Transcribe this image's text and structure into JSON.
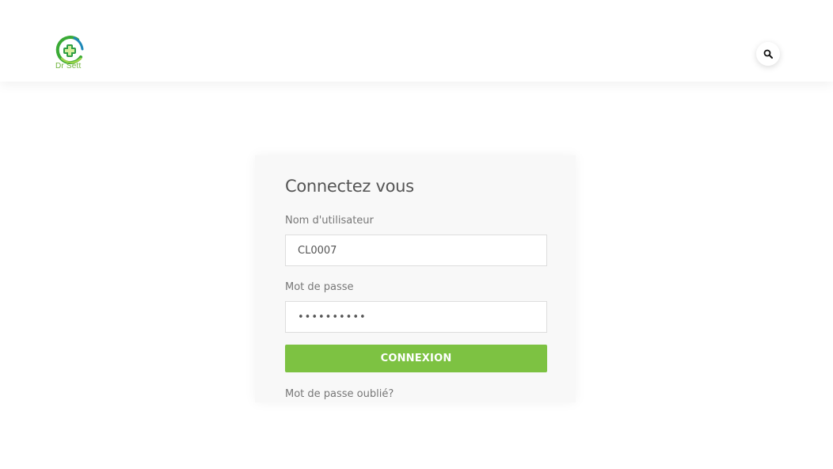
{
  "header": {
    "logo_text": "Dr Sett",
    "search_icon": "search-icon"
  },
  "login": {
    "title": "Connectez vous",
    "username_label": "Nom d'utilisateur",
    "username_value": "CL0007",
    "password_label": "Mot de passe",
    "password_value": "••••••••••",
    "submit_label": "CONNEXION",
    "forgot_label": "Mot de passe oublié?"
  },
  "colors": {
    "accent": "#7dc242",
    "logo_green": "#6fb33a",
    "card_bg": "#f8f8f8",
    "text": "#555555"
  }
}
